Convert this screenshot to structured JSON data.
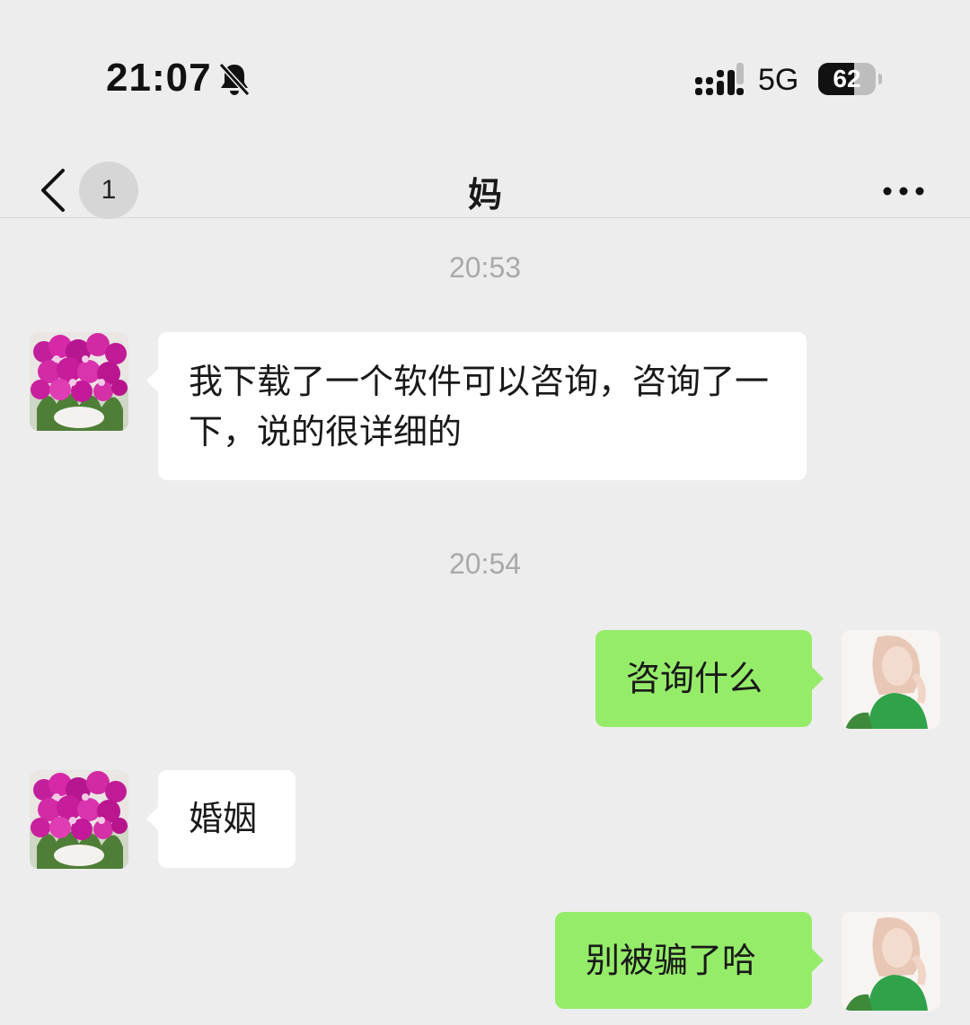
{
  "status_bar": {
    "time": "21:07",
    "network": "5G",
    "battery": "62",
    "battery_level": 0.62,
    "icons": [
      "bell-slash-icon",
      "signal-bars-icon"
    ]
  },
  "nav": {
    "back_icon": "chevron-left-icon",
    "unread_count": "1",
    "title": "妈",
    "more_icon": "ellipsis-icon"
  },
  "messages": [
    {
      "type": "timestamp",
      "text": "20:53"
    },
    {
      "type": "incoming",
      "sender": "妈",
      "avatar": "orchid-flowers-avatar",
      "text": "我下载了一个软件可以咨询，咨询了一下，说的很详细的"
    },
    {
      "type": "timestamp",
      "text": "20:54"
    },
    {
      "type": "outgoing",
      "avatar": "woman-green-shirt-avatar",
      "text": "咨询什么"
    },
    {
      "type": "incoming",
      "sender": "妈",
      "avatar": "orchid-flowers-avatar",
      "text": "婚姻"
    },
    {
      "type": "outgoing",
      "avatar": "woman-green-shirt-avatar",
      "text": "别被骗了哈"
    }
  ],
  "colors": {
    "background": "#ededed",
    "incoming_bubble": "#ffffff",
    "outgoing_bubble": "#95ec69",
    "timestamp": "#a9a9a9"
  }
}
